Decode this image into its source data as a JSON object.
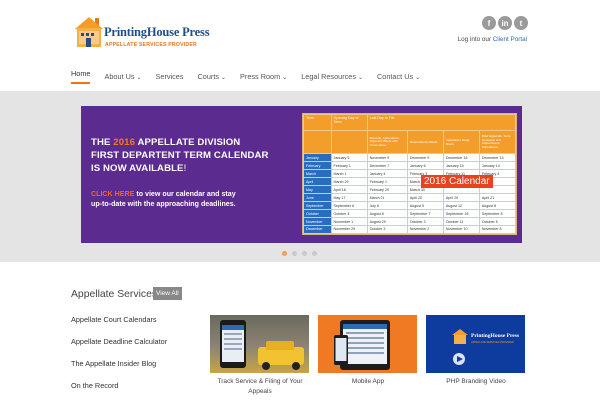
{
  "header": {
    "logo": {
      "name_part1": "PrintingHouse",
      "name_part2": "Press",
      "tagline": "APPELLATE SERVICES PROVIDER"
    },
    "social": [
      {
        "icon": "facebook-icon",
        "glyph": "f"
      },
      {
        "icon": "linkedin-icon",
        "glyph": "in"
      },
      {
        "icon": "twitter-icon",
        "glyph": "t"
      }
    ],
    "login_prefix": "Log into our",
    "login_link": "Client Portal"
  },
  "nav": {
    "items": [
      {
        "label": "Home",
        "active": true,
        "has_dropdown": false
      },
      {
        "label": "About Us",
        "has_dropdown": true
      },
      {
        "label": "Services",
        "has_dropdown": false
      },
      {
        "label": "Courts",
        "has_dropdown": true
      },
      {
        "label": "Press Room",
        "has_dropdown": true
      },
      {
        "label": "Legal Resources",
        "has_dropdown": true
      },
      {
        "label": "Contact Us",
        "has_dropdown": true
      }
    ]
  },
  "slide": {
    "line1_prefix": "THE",
    "year": "2016",
    "line1_suffix": "APPELLATE DIVISION",
    "line2": "FIRST DEPARTENT TERM CALENDAR",
    "line3_main": "IS NOW AVAILABLE",
    "line3_bang": "!",
    "cta_click": "CLICK HERE",
    "cta_rest1": "to view our calendar and stay",
    "cta_line2": "up-to-date with the approaching deadlines.",
    "calendar_badge": "2016 Calendar",
    "calendar": {
      "headers": [
        "Term",
        "Opening Day of Term",
        "Last Day to File"
      ],
      "subheaders": [
        "",
        "",
        "Records, Appendices, Appendix Briefs with Cross-Issue",
        "Respondent's Briefs",
        "Appellant's Reply Briefs",
        "Brief Appendix, Term Requests and Adjournment Stipulations"
      ],
      "rows": [
        [
          "January",
          "January 5",
          "November 9",
          "December 9",
          "December 16",
          "December 13"
        ],
        [
          "February",
          "February 1",
          "December 7",
          "January 6",
          "January 15",
          "January 14"
        ],
        [
          "March",
          "March 1",
          "January 4",
          "February 3",
          "February 11",
          "February 4"
        ],
        [
          "April",
          "March 29",
          "February 1",
          "March 2",
          "",
          ""
        ],
        [
          "May",
          "April 18",
          "February 29",
          "March 30",
          "",
          ""
        ],
        [
          "June",
          "May 17",
          "March 21",
          "April 20",
          "April 29",
          "April 21"
        ],
        [
          "September",
          "September 6",
          "July 6",
          "August 5",
          "August 12",
          "August 8"
        ],
        [
          "October",
          "October 4",
          "August 8",
          "September 7",
          "September 16",
          "September 8"
        ],
        [
          "November",
          "November 1",
          "August 29",
          "October 3",
          "October 11",
          "October 5"
        ],
        [
          "December",
          "November 29",
          "October 3",
          "November 2",
          "November 10",
          "November 8"
        ]
      ]
    }
  },
  "slider_dots": [
    true,
    false,
    false,
    false
  ],
  "appellate": {
    "title": "Appellate Services",
    "view_all": "View All",
    "links": [
      "Appellate Court Calendars",
      "Appellate Deadline Calculator",
      "The Appellate Insider Blog",
      "On the Record"
    ]
  },
  "tiles": [
    {
      "caption_line1": "Track Service & Filing of Your",
      "caption_line2": "Appeals"
    },
    {
      "caption_line1": "Mobile App",
      "caption_line2": ""
    },
    {
      "caption_line1": "PHP Branding Video",
      "caption_line2": ""
    }
  ],
  "video_logo": {
    "name": "PrintingHouse Press",
    "tagline": "APPELLATE SERVICES PROVIDER"
  },
  "colors": {
    "accent_orange": "#e8771e",
    "brand_blue": "#1f4e8c",
    "slide_purple": "#5c2b8f",
    "link_blue": "#2d6cb5"
  }
}
